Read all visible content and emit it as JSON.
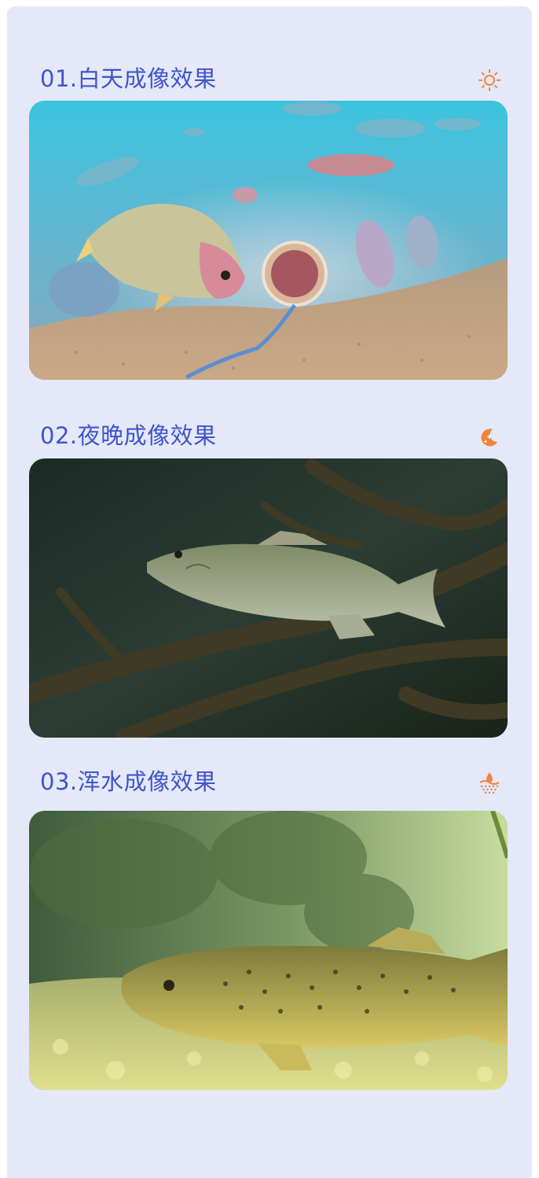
{
  "sections": [
    {
      "title": "01.白天成像效果",
      "icon": "sun-icon",
      "image": "underwater-daytime-fish-photo"
    },
    {
      "title": "02.夜晚成像效果",
      "icon": "moon-stars-icon",
      "image": "underwater-night-bass-photo"
    },
    {
      "title": "03.浑水成像效果",
      "icon": "water-drop-icon",
      "image": "underwater-murky-trout-photo"
    }
  ],
  "colors": {
    "title": "#3f55c9",
    "icon_accent": "#f0843c",
    "background": "#e4e8f9"
  }
}
